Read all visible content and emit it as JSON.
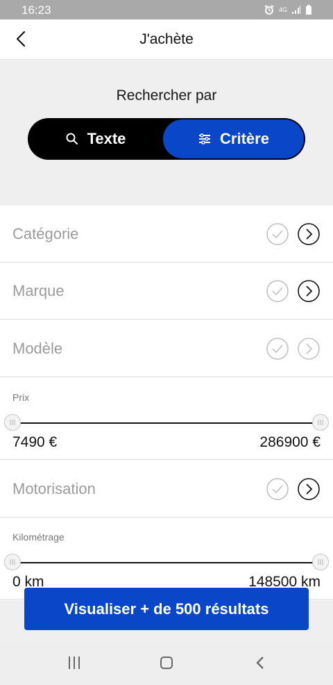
{
  "status": {
    "time": "16:23",
    "network": "4G"
  },
  "header": {
    "title": "J'achète"
  },
  "search": {
    "label": "Rechercher par",
    "text_tab": "Texte",
    "criteria_tab": "Critère"
  },
  "filters": [
    {
      "label": "Catégorie"
    },
    {
      "label": "Marque"
    },
    {
      "label": "Modèle"
    }
  ],
  "price": {
    "label": "Prix",
    "min": "7490 €",
    "max": "286900 €"
  },
  "motor": {
    "label": "Motorisation"
  },
  "mileage": {
    "label": "Kilométrage",
    "min": "0 km",
    "max": "148500 km"
  },
  "footer": {
    "button": "Visualiser + de 500 résultats"
  },
  "colors": {
    "accent": "#0a46c8",
    "dark": "#000000"
  }
}
